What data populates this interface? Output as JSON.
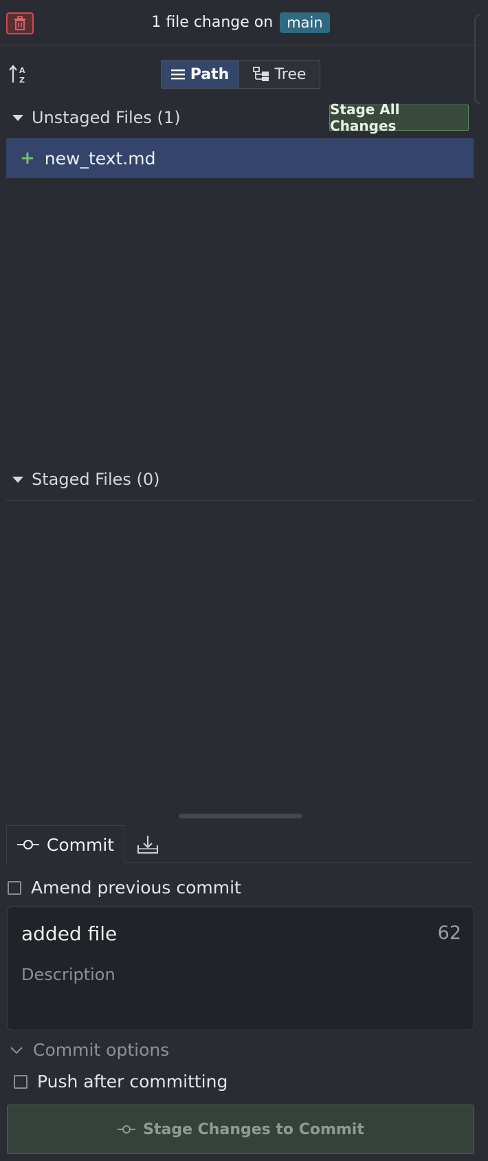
{
  "header": {
    "title_prefix": "1 file change on",
    "branch": "main"
  },
  "toolbar": {
    "path_label": "Path",
    "tree_label": "Tree"
  },
  "unstaged": {
    "heading": "Unstaged Files (1)",
    "stage_all_label": "Stage All Changes",
    "files": [
      {
        "status": "+",
        "name": "new_text.md"
      }
    ]
  },
  "staged": {
    "heading": "Staged Files (0)"
  },
  "commit_panel": {
    "tab_commit_label": "Commit",
    "amend_label": "Amend previous commit",
    "summary_value": "added file",
    "summary_remaining": "62",
    "description_placeholder": "Description",
    "options_label": "Commit options",
    "push_label": "Push after committing",
    "submit_label": "Stage Changes to Commit"
  },
  "colors": {
    "background": "#2a2c33",
    "selection": "#34446a",
    "accent_green": "#6fc26a",
    "branch_pill": "#2f6a80",
    "danger": "#d04a4a"
  },
  "icons": [
    "trash-icon",
    "sort-az-icon",
    "list-icon",
    "tree-icon",
    "caret-down-icon",
    "commit-icon",
    "stash-icon",
    "chevron-down-icon"
  ]
}
